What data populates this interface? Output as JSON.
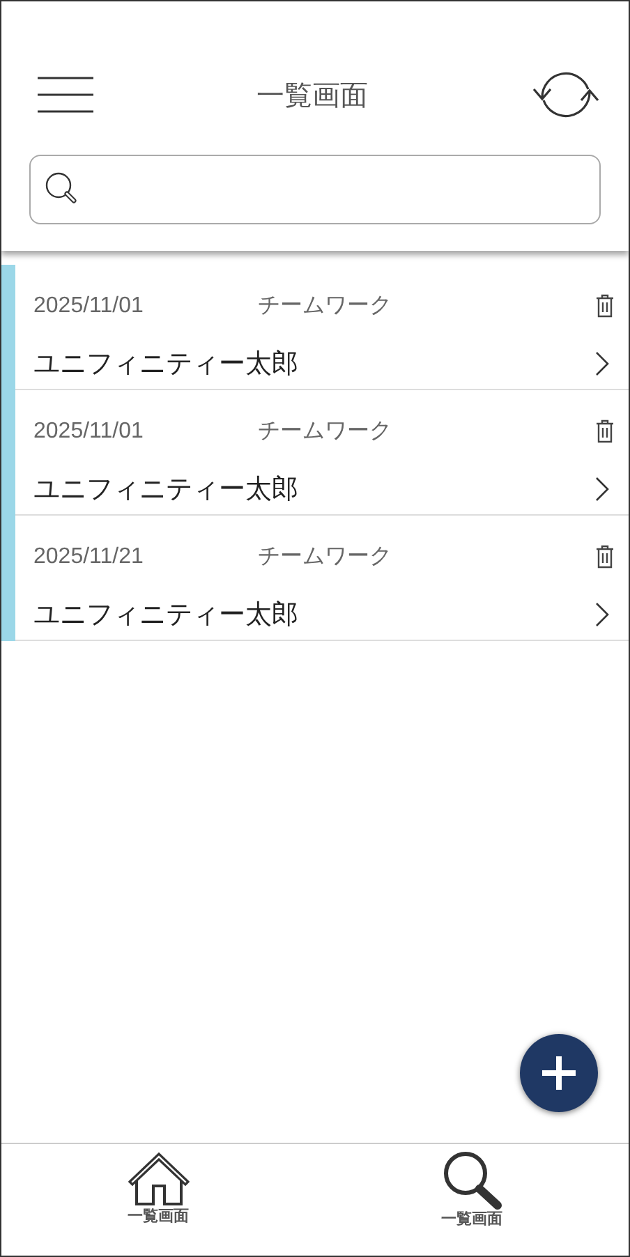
{
  "header": {
    "title": "一覧画面"
  },
  "records": [
    {
      "date": "2025/11/01",
      "category": "チームワーク",
      "name": "ユニフィニティー太郎"
    },
    {
      "date": "2025/11/01",
      "category": "チームワーク",
      "name": "ユニフィニティー太郎"
    },
    {
      "date": "2025/11/21",
      "category": "チームワーク",
      "name": "ユニフィニティー太郎"
    }
  ],
  "bottom_nav": [
    {
      "kind": "home",
      "label": "一覧画面"
    },
    {
      "kind": "search",
      "label": "一覧画面"
    }
  ]
}
